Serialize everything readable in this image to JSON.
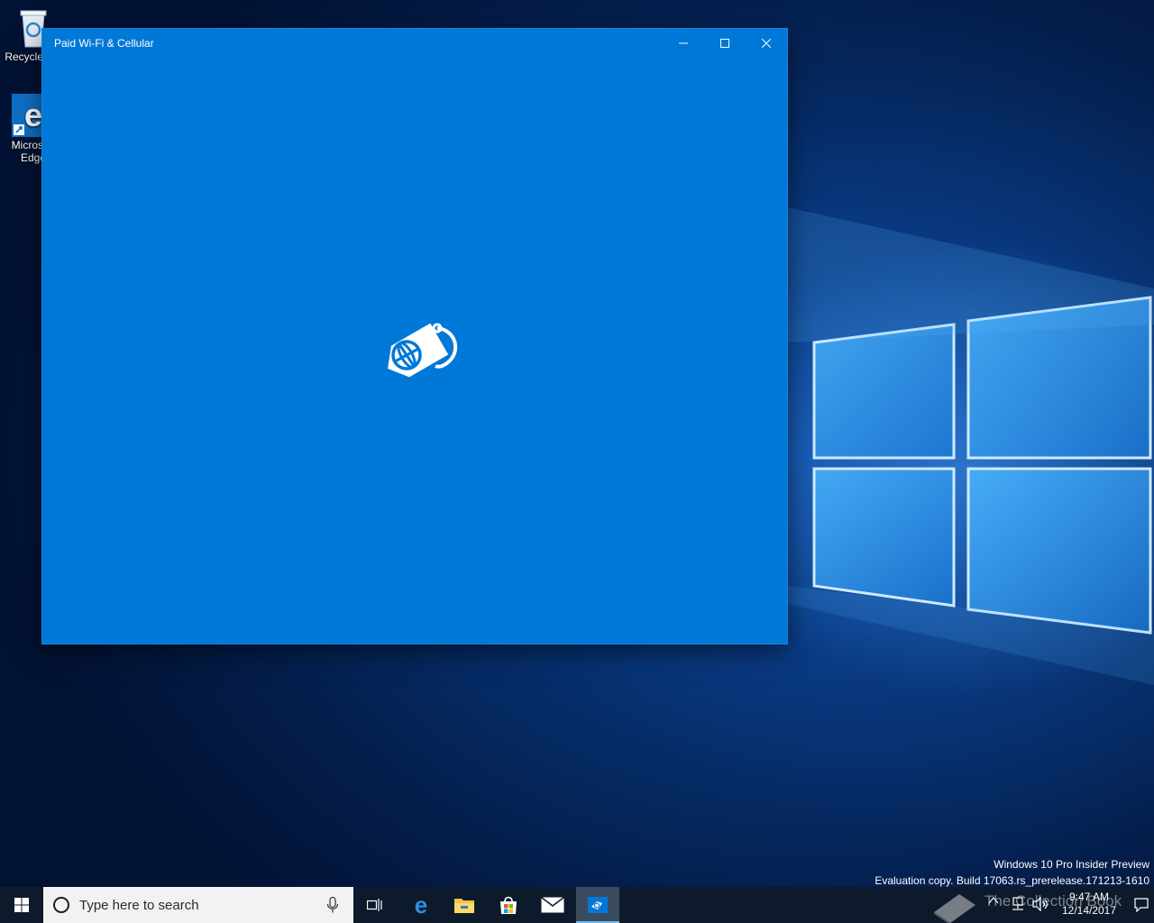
{
  "desktop": {
    "icons": [
      {
        "label": "Recycle Bin",
        "icon": "recycle-bin-icon"
      },
      {
        "label": "Microsoft Edge",
        "icon": "edge-icon"
      }
    ],
    "watermark": {
      "line1": "Windows 10 Pro Insider Preview",
      "line2": "Evaluation copy. Build 17063.rs_prerelease.171213-1610"
    }
  },
  "window": {
    "title": "Paid Wi-Fi & Cellular",
    "background_color": "#0078d7",
    "splash_icon": "sim-tag-globe-icon",
    "caption_buttons": [
      "minimize-icon",
      "maximize-icon",
      "close-icon"
    ]
  },
  "taskbar": {
    "search_placeholder": "Type here to search",
    "pinned": [
      "task-view-icon",
      "edge-icon",
      "file-explorer-icon",
      "store-icon",
      "mail-icon",
      "paid-wifi-icon"
    ],
    "active_app": "paid-wifi-icon",
    "tray": {
      "watermark_text": "The Collection Book",
      "time": "9:47 AM",
      "date": "12/14/2017"
    }
  }
}
